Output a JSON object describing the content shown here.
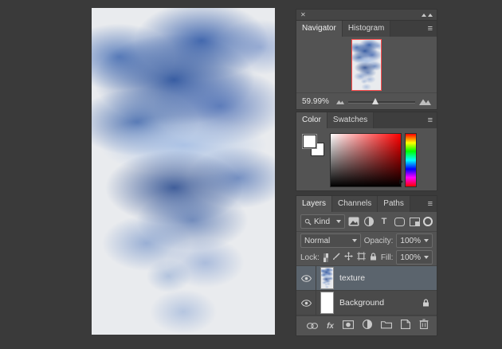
{
  "window": {
    "close_glyph": "✕"
  },
  "icons": {
    "menu_glyph": "≡"
  },
  "colors": {
    "background": "#3a3a3a",
    "panel_bg": "#535353",
    "navigator_proxy_border": "#ff4b4b",
    "selected_layer_bg": "#5b646d"
  },
  "navigator": {
    "tabs": [
      "Navigator",
      "Histogram"
    ],
    "active_tab": "Navigator",
    "zoom": "59.99%"
  },
  "color_panel": {
    "tabs": [
      "Color",
      "Swatches"
    ],
    "active_tab": "Color"
  },
  "layers_panel": {
    "tabs": [
      "Layers",
      "Channels",
      "Paths"
    ],
    "active_tab": "Layers",
    "filter_kind_label": "Kind",
    "filter_text_glyph": "T",
    "blend_mode": "Normal",
    "opacity_label": "Opacity:",
    "opacity_value": "100%",
    "lock_label": "Lock:",
    "fill_label": "Fill:",
    "fill_value": "100%",
    "fx_label": "fx",
    "layers": [
      {
        "name": "texture",
        "visible": true,
        "selected": true
      },
      {
        "name": "Background",
        "visible": true,
        "selected": false,
        "locked": true
      }
    ]
  }
}
